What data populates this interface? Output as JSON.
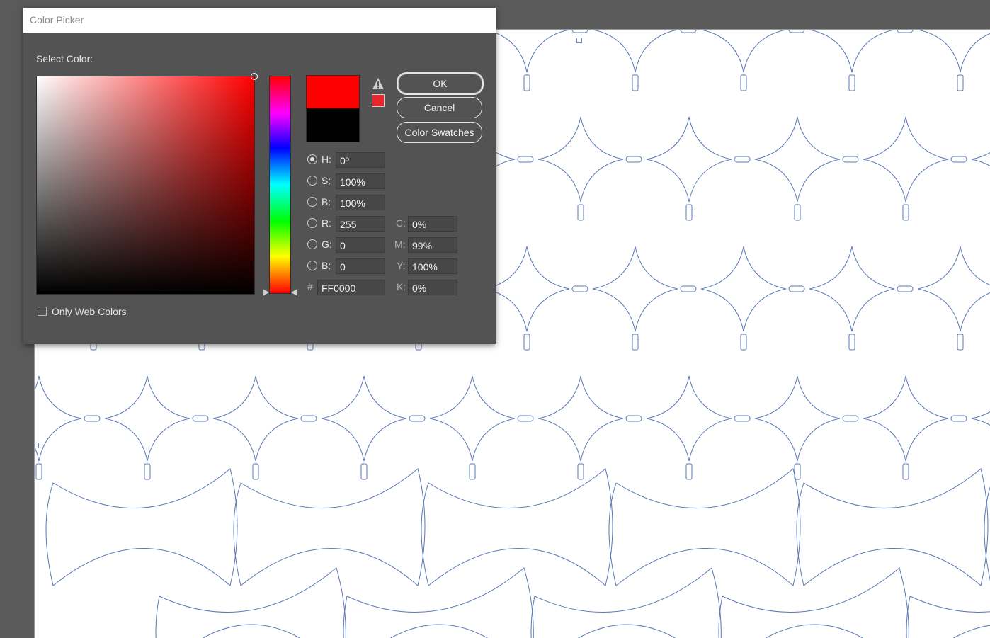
{
  "dialog": {
    "title": "Color Picker",
    "select_color_label": "Select Color:",
    "only_web_colors_label": "Only Web Colors",
    "only_web_colors_checked": false,
    "buttons": {
      "ok": "OK",
      "cancel": "Cancel",
      "color_swatches": "Color Swatches"
    },
    "icons": [
      "warning-icon",
      "out-of-gamut-cube-icon"
    ],
    "new_color": "#ff0000",
    "previous_color": "#000000",
    "selected_mode": "H",
    "fields": {
      "h": {
        "label": "H:",
        "value": "0º"
      },
      "s": {
        "label": "S:",
        "value": "100%"
      },
      "b": {
        "label": "B:",
        "value": "100%"
      },
      "r": {
        "label": "R:",
        "value": "255"
      },
      "g": {
        "label": "G:",
        "value": "0"
      },
      "b2": {
        "label": "B:",
        "value": "0"
      },
      "hex": {
        "label": "#",
        "value": "FF0000"
      },
      "c": {
        "label": "C:",
        "value": "0%"
      },
      "m": {
        "label": "M:",
        "value": "99%"
      },
      "y": {
        "label": "Y:",
        "value": "100%"
      },
      "k": {
        "label": "K:",
        "value": "0%"
      }
    }
  },
  "colors": {
    "workspace": "#5a5a5a",
    "dialog_bg": "#535353",
    "artwork_stroke": "#5b78b5"
  }
}
